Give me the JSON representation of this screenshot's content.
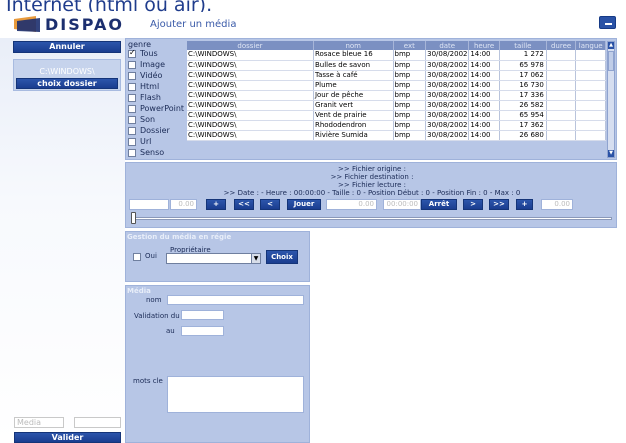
{
  "window": {
    "top_text": "Internet (html ou air).",
    "logo": "DISPAO",
    "title": "Ajouter un média",
    "minimize_icon": "minimize-icon"
  },
  "sidebar": {
    "cancel_label": "Annuler",
    "current_path": "C:\\WINDOWS\\",
    "choose_folder_label": "choix dossier",
    "media_placeholder": "Media",
    "validate_label": "Valider"
  },
  "genre": {
    "label": "genre",
    "items": [
      {
        "label": "Tous",
        "checked": true
      },
      {
        "label": "Image",
        "checked": false
      },
      {
        "label": "Vidéo",
        "checked": false
      },
      {
        "label": "Html",
        "checked": false
      },
      {
        "label": "Flash",
        "checked": false
      },
      {
        "label": "PowerPoint",
        "checked": false
      },
      {
        "label": "Son",
        "checked": false
      },
      {
        "label": "Dossier",
        "checked": false
      },
      {
        "label": "Url",
        "checked": false
      },
      {
        "label": "Senso",
        "checked": false
      }
    ]
  },
  "table": {
    "headers": [
      "dossier",
      "nom",
      "ext",
      "date",
      "heure",
      "taille",
      "duree",
      "langue"
    ],
    "rows": [
      [
        "C:\\WINDOWS\\",
        "Rosace bleue 16",
        "bmp",
        "30/08/2002",
        "14:00",
        "1 272",
        "",
        ""
      ],
      [
        "C:\\WINDOWS\\",
        "Bulles de savon",
        "bmp",
        "30/08/2002",
        "14:00",
        "65 978",
        "",
        ""
      ],
      [
        "C:\\WINDOWS\\",
        "Tasse à café",
        "bmp",
        "30/08/2002",
        "14:00",
        "17 062",
        "",
        ""
      ],
      [
        "C:\\WINDOWS\\",
        "Plume",
        "bmp",
        "30/08/2002",
        "14:00",
        "16 730",
        "",
        ""
      ],
      [
        "C:\\WINDOWS\\",
        "Jour de pêche",
        "bmp",
        "30/08/2002",
        "14:00",
        "17 336",
        "",
        ""
      ],
      [
        "C:\\WINDOWS\\",
        "Granit vert",
        "bmp",
        "30/08/2002",
        "14:00",
        "26 582",
        "",
        ""
      ],
      [
        "C:\\WINDOWS\\",
        "Vent de prairie",
        "bmp",
        "30/08/2002",
        "14:00",
        "65 954",
        "",
        ""
      ],
      [
        "C:\\WINDOWS\\",
        "Rhododendron",
        "bmp",
        "30/08/2002",
        "14:00",
        "17 362",
        "",
        ""
      ],
      [
        "C:\\WINDOWS\\",
        "Rivière Sumida",
        "bmp",
        "30/08/2002",
        "14:00",
        "26 680",
        "",
        ""
      ]
    ]
  },
  "player": {
    "origin_line": ">> Fichier origine :",
    "dest_line": ">> Fichier destination :",
    "read_line": ">> Fichier lecture :",
    "info_line": ">> Date : - Heure : 00:00:00 - Taille : 0 - Position Début : 0 - Position Fin : 0 - Max : 0",
    "field_start": "",
    "field_start_val": "0.00",
    "plus1": "+",
    "rewind": "<<",
    "back": "<",
    "play": "Jouer",
    "field_mid": "0.00",
    "field_time": "00:00:00",
    "stop": "Arrêt",
    "forward": ">",
    "fast_forward": ">>",
    "plus2": "+",
    "field_end": "0.00"
  },
  "gestion": {
    "title": "Gestion du média en régie",
    "owner_label": "Propriétaire",
    "oui_label": "Oui",
    "choix_label": "Choix"
  },
  "media": {
    "title": "Média",
    "nom_label": "nom",
    "validation_label": "Validation du",
    "au_label": "au",
    "keywords_label": "mots cle"
  },
  "colors": {
    "accent": "#1f3c8c",
    "panel": "#b7c6e6",
    "header_row": "#7b90c2",
    "button": "#1a3d8f"
  }
}
